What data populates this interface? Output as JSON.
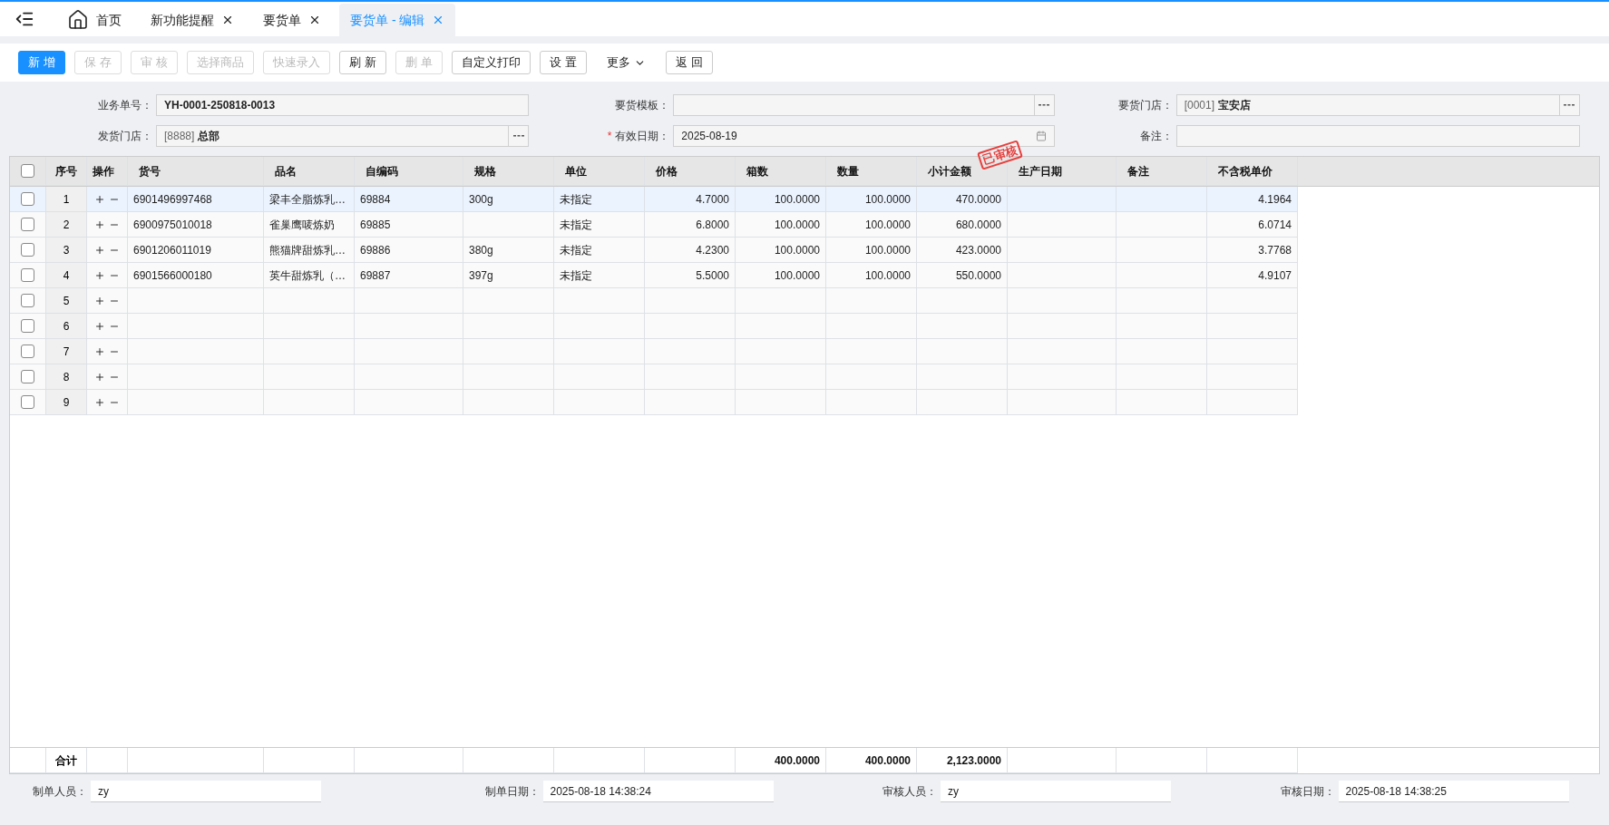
{
  "tabs": [
    {
      "label": "首页",
      "kind": "home",
      "selected": false
    },
    {
      "label": "新功能提醒",
      "kind": "closable",
      "selected": false
    },
    {
      "label": "要货单",
      "kind": "closable",
      "selected": false
    },
    {
      "label": "要货单 - 编辑",
      "kind": "closable",
      "selected": true
    }
  ],
  "toolbar": [
    {
      "label": "新 增",
      "kind": "primary",
      "disabled": false
    },
    {
      "label": "保 存",
      "kind": "plain",
      "disabled": true
    },
    {
      "label": "审 核",
      "kind": "plain",
      "disabled": true
    },
    {
      "label": "选择商品",
      "kind": "plain",
      "disabled": true
    },
    {
      "label": "快速录入",
      "kind": "plain",
      "disabled": true
    },
    {
      "label": "刷 新",
      "kind": "plain",
      "disabled": false
    },
    {
      "label": "删 单",
      "kind": "plain",
      "disabled": true
    },
    {
      "label": "自定义打印",
      "kind": "plain",
      "disabled": false
    },
    {
      "label": "设 置",
      "kind": "plain",
      "disabled": false
    },
    {
      "label": "更多",
      "kind": "dropdown",
      "disabled": false
    },
    {
      "label": "返 回",
      "kind": "plain",
      "disabled": false
    }
  ],
  "form": [
    {
      "label": "业务单号：",
      "kind": "text",
      "value": "YH-0001-250818-0013"
    },
    {
      "label": "要货模板：",
      "kind": "lookup"
    },
    {
      "label": "要货门店：",
      "kind": "lookup",
      "code": "[0001]",
      "value": "宝安店"
    },
    {
      "label": "发货门店：",
      "kind": "lookup",
      "code": "[8888]",
      "value": "总部"
    },
    {
      "label": "有效日期：",
      "kind": "date",
      "value": "2025-08-19",
      "required_mark": "*"
    },
    {
      "label": "备注：",
      "kind": "text"
    }
  ],
  "stamp": {
    "text": "已审核"
  },
  "table": {
    "all_checked": false,
    "columns": [
      {
        "label": "序号"
      },
      {
        "label": "操作"
      },
      {
        "label": "货号"
      },
      {
        "label": "品名"
      },
      {
        "label": "自编码"
      },
      {
        "label": "规格"
      },
      {
        "label": "单位"
      },
      {
        "label": "价格",
        "numeric": true
      },
      {
        "label": "箱数",
        "numeric": true,
        "total": "400.0000"
      },
      {
        "label": "数量",
        "numeric": true,
        "total": "400.0000"
      },
      {
        "label": "小计金额",
        "numeric": true,
        "total": "2,123.0000"
      },
      {
        "label": "生产日期"
      },
      {
        "label": "备注"
      },
      {
        "label": "不含税单价",
        "numeric": true
      }
    ],
    "total_label": "合计",
    "rows": [
      {
        "number": "1",
        "checked": false,
        "selected": true,
        "cells": [
          "6901496997468",
          "梁丰全脂炼乳…",
          "69884",
          "300g",
          "未指定",
          "4.7000",
          "100.0000",
          "100.0000",
          "470.0000",
          null,
          null,
          "4.1964"
        ]
      },
      {
        "number": "2",
        "checked": false,
        "selected": false,
        "cells": [
          "6900975010018",
          "雀巢鹰唛炼奶",
          "69885",
          null,
          "未指定",
          "6.8000",
          "100.0000",
          "100.0000",
          "680.0000",
          null,
          null,
          "6.0714"
        ]
      },
      {
        "number": "3",
        "checked": false,
        "selected": false,
        "cells": [
          "6901206011019",
          "熊猫牌甜炼乳…",
          "69886",
          "380g",
          "未指定",
          "4.2300",
          "100.0000",
          "100.0000",
          "423.0000",
          null,
          null,
          "3.7768"
        ]
      },
      {
        "number": "4",
        "checked": false,
        "selected": false,
        "cells": [
          "6901566000180",
          "英牛甜炼乳（…",
          "69887",
          "397g",
          "未指定",
          "5.5000",
          "100.0000",
          "100.0000",
          "550.0000",
          null,
          null,
          "4.9107"
        ]
      },
      {
        "number": "5",
        "checked": false,
        "selected": false
      },
      {
        "number": "6",
        "checked": false,
        "selected": false
      },
      {
        "number": "7",
        "checked": false,
        "selected": false
      },
      {
        "number": "8",
        "checked": false,
        "selected": false
      },
      {
        "number": "9",
        "checked": false,
        "selected": false
      }
    ]
  },
  "footer": [
    {
      "label": "制单人员：",
      "value": "zy"
    },
    {
      "label": "制单日期：",
      "value": "2025-08-18 14:38:24"
    },
    {
      "label": "审核人员：",
      "value": "zy"
    },
    {
      "label": "审核日期：",
      "value": "2025-08-18 14:38:25"
    }
  ]
}
